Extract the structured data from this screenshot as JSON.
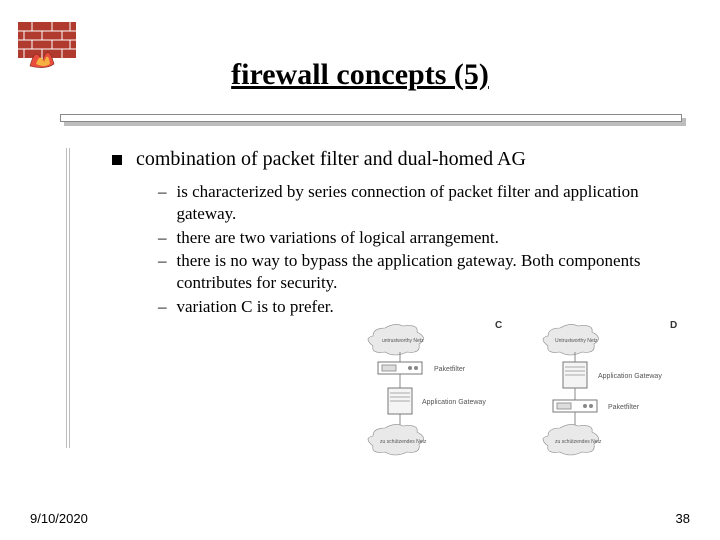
{
  "title": "firewall concepts (5)",
  "main_bullet": "combination of packet filter and dual-homed AG",
  "sub_bullets": [
    "is characterized by series connection of packet filter and application gateway.",
    "there are two variations of logical arrangement.",
    "there is no way to bypass the application gateway. Both components contributes for security.",
    "variation C is to prefer."
  ],
  "diagram": {
    "label_c": "C",
    "label_d": "D",
    "net_top_c": "untrustworthy Netz",
    "net_top_d": "Untrustworthy Netz",
    "pf": "Paketfilter",
    "ag": "Application Gateway",
    "net_bottom": "zu schützendes Netz"
  },
  "footer": {
    "date": "9/10/2020",
    "page": "38"
  }
}
